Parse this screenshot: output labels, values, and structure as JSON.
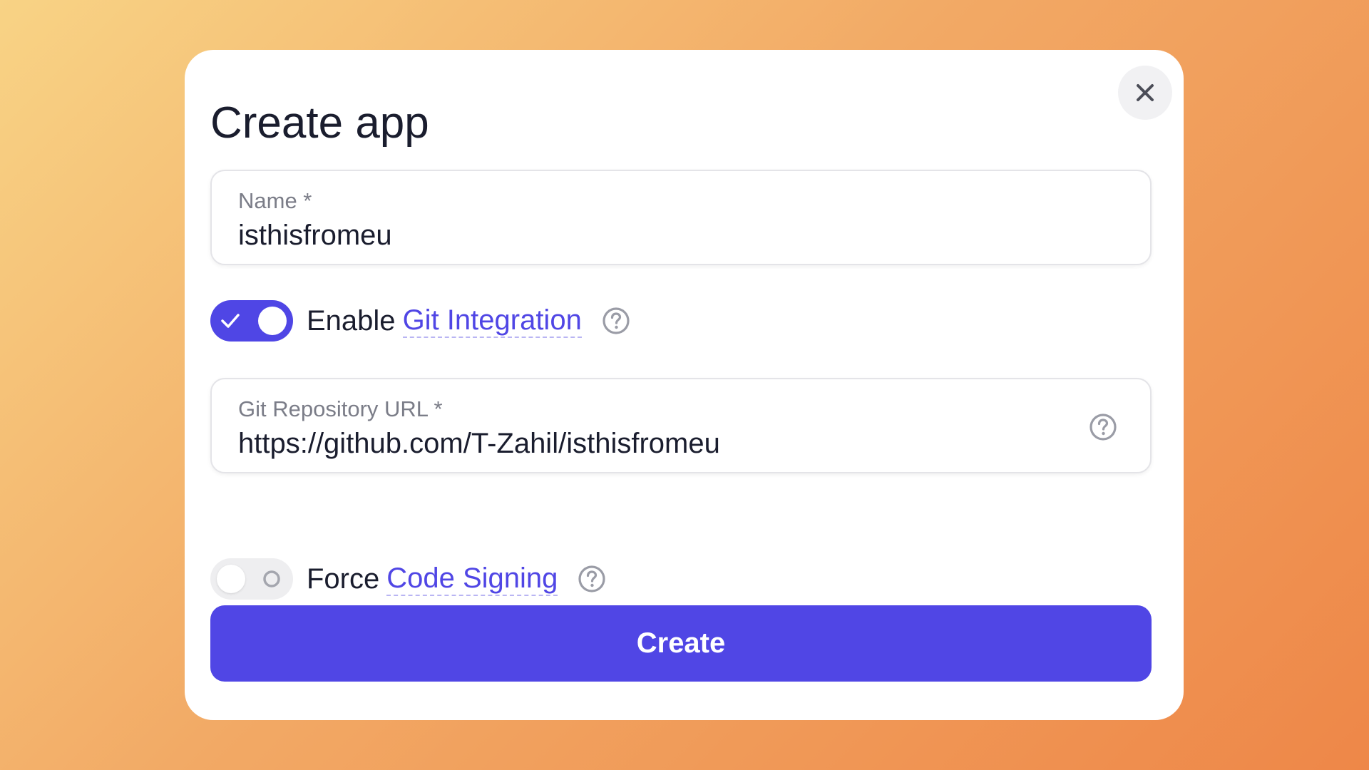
{
  "modal": {
    "title": "Create app",
    "close_icon": "close-icon"
  },
  "name_field": {
    "label": "Name *",
    "value": "isthisfromeu"
  },
  "git_integration": {
    "enabled": true,
    "prefix": "Enable",
    "link_text": "Git Integration",
    "help_icon": "question-circle-icon"
  },
  "repo_field": {
    "label": "Git Repository URL *",
    "value": "https://github.com/T-Zahil/isthisfromeu",
    "help_icon": "question-circle-icon"
  },
  "code_signing": {
    "enabled": false,
    "prefix": "Force",
    "link_text": "Code Signing",
    "help_icon": "question-circle-icon"
  },
  "create_button": {
    "label": "Create"
  },
  "colors": {
    "accent": "#4f46e5",
    "link": "#5046e5",
    "text": "#1a1d2e",
    "muted": "#7b7d88",
    "background_start": "#f8d385",
    "background_end": "#ee8748"
  }
}
